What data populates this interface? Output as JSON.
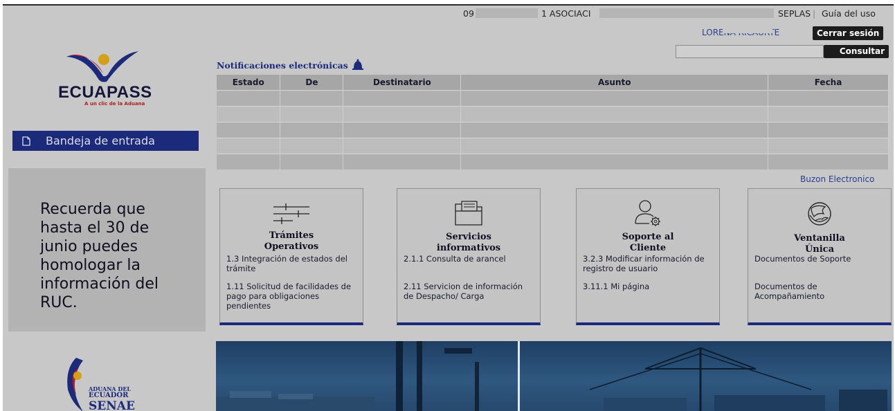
{
  "header": {
    "ruc": "09",
    "company": "1 ASOCIACI",
    "account": "SEPLAS",
    "separator": "|",
    "guide_link": "Guía del uso",
    "user_name": "LORENA RICAURTE",
    "logout_label": "Cerrar sesión",
    "search_value": "",
    "search_button": "Consultar"
  },
  "logo": {
    "name": "ECUAPASS",
    "tagline": "A un clic de la Aduana"
  },
  "sidebar": {
    "inbox_label": "Bandeja de entrada",
    "promo_text": "Recuerda que hasta el 30 de junio puedes homologar la información del RUC.",
    "footer_logo": {
      "line1": "ADUANA DEL",
      "line2": "ECUADOR",
      "line3": "SENAE"
    }
  },
  "notifications": {
    "title": "Notificaciones electrónicas",
    "columns": [
      "Estado",
      "De",
      "Destinatario",
      "Asunto",
      "Fecha"
    ],
    "rows": [
      [],
      [],
      [],
      [],
      []
    ],
    "mailbox_link": "Buzon Electronico"
  },
  "cards": [
    {
      "icon": "sliders-icon",
      "title_line1": "Trámites",
      "title_line2": "Operativos",
      "link1": "1.3 Integración de estados del trámite",
      "link2": "1.11 Solicitud de facilidades de pago para obligaciones pendientes"
    },
    {
      "icon": "folder-icon",
      "title_line1": "Servicios",
      "title_line2": "informativos",
      "link1": "2.1.1 Consulta de arancel",
      "link2": "2.11 Servicion de información de Despacho/ Carga"
    },
    {
      "icon": "user-gear-icon",
      "title_line1": "Soporte al",
      "title_line2": "Cliente",
      "link1": "3.2.3 Modificar información de registro de usuario",
      "link2": "3.11.1 Mi página"
    },
    {
      "icon": "globe-hands-icon",
      "title_line1": "Ventanilla",
      "title_line2": "Única",
      "link1": "Documentos de Soporte",
      "link2": "Documentos de Acompañamiento"
    }
  ],
  "colors": {
    "brand_navy": "#1b2a7a",
    "link_blue": "#2b3d8f",
    "overlay_gray": "#c8c8c8"
  }
}
